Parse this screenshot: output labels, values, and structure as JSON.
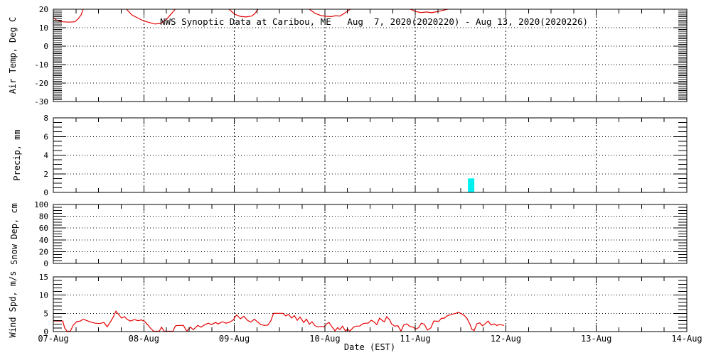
{
  "title": "NWS Synoptic Data at Caribou, ME   Aug  7, 2020(2020220) - Aug 13, 2020(2020226)",
  "line_color": "#e60000",
  "bar_color": "#00f0f0",
  "x_axis": {
    "label": "Date (EST)",
    "tick_labels": [
      "07-Aug",
      "08-Aug",
      "09-Aug",
      "10-Aug",
      "11-Aug",
      "12-Aug",
      "13-Aug",
      "14-Aug"
    ],
    "range_hours": [
      0,
      168
    ],
    "minor_tick_hours": 6,
    "major_tick_hours": 24
  },
  "chart_data": [
    {
      "id": "air-temp",
      "type": "line",
      "ylabel": "Air Temp, Deg C",
      "ylim": [
        -30,
        20
      ],
      "yticks": [
        -30,
        -20,
        -10,
        0,
        10,
        20
      ],
      "grid_yticks": [
        -20,
        -10,
        0,
        10
      ],
      "y_minor_step": 1,
      "clip_note": "curve clipped at 20 C panel top; data ends 12-Aug",
      "series": [
        {
          "name": "air-temp",
          "points": [
            [
              0,
              15.5
            ],
            [
              0.9,
              14
            ],
            [
              2.5,
              13.2
            ],
            [
              4.2,
              13
            ],
            [
              5.7,
              13.2
            ],
            [
              6.6,
              14.8
            ],
            [
              7.4,
              17
            ],
            [
              7.9,
              20
            ],
            [
              9.5,
              23
            ],
            [
              19.4,
              20
            ],
            [
              20.9,
              16.8
            ],
            [
              24,
              13.6
            ],
            [
              26.9,
              12
            ],
            [
              28.5,
              12.3
            ],
            [
              30,
              14.5
            ],
            [
              31.5,
              18
            ],
            [
              32.3,
              20
            ],
            [
              38.7,
              24
            ],
            [
              46.6,
              20
            ],
            [
              48.1,
              17.3
            ],
            [
              49.6,
              16.1
            ],
            [
              51.1,
              15.8
            ],
            [
              52.6,
              16.3
            ],
            [
              53.4,
              17.5
            ],
            [
              54.3,
              20
            ],
            [
              61.3,
              23
            ],
            [
              67.9,
              20
            ],
            [
              69.4,
              17.8
            ],
            [
              70.9,
              16.6
            ],
            [
              72.2,
              16.2
            ],
            [
              73.7,
              16
            ],
            [
              74.9,
              16.5
            ],
            [
              76,
              16.3
            ],
            [
              77.3,
              18
            ],
            [
              78.8,
              20
            ],
            [
              85.8,
              23
            ],
            [
              94.7,
              20
            ],
            [
              96.2,
              18.7
            ],
            [
              97.5,
              18.2
            ],
            [
              99,
              18.5
            ],
            [
              100.3,
              18.1
            ],
            [
              101.8,
              18.7
            ],
            [
              103.3,
              19.4
            ],
            [
              104.6,
              20
            ],
            [
              110.3,
              23
            ],
            [
              119.6,
              23
            ]
          ]
        }
      ]
    },
    {
      "id": "precip",
      "type": "bar",
      "ylabel": "Precip, mm",
      "ylim": [
        0,
        8
      ],
      "yticks": [
        0,
        2,
        4,
        6,
        8
      ],
      "grid_yticks": [
        2,
        4,
        6
      ],
      "y_minor_step": 0.5,
      "bars": [
        {
          "center_hour": 110.8,
          "width_hours": 1.7,
          "value_mm": 1.5
        }
      ],
      "series": []
    },
    {
      "id": "snow-depth",
      "type": "line",
      "ylabel": "Snow Dep, cm",
      "ylim": [
        0,
        100
      ],
      "yticks": [
        0,
        20,
        40,
        60,
        80,
        100
      ],
      "grid_yticks": [
        20,
        40,
        60,
        80
      ],
      "y_minor_step": 5,
      "series": []
    },
    {
      "id": "wind-speed",
      "type": "line",
      "ylabel": "Wind Spd, m/s",
      "ylim": [
        0,
        15
      ],
      "yticks": [
        0,
        5,
        10,
        15
      ],
      "grid_yticks": [
        5,
        10
      ],
      "y_minor_step": 1,
      "clip_note": "data ends 12-Aug",
      "series": [
        {
          "name": "wind-speed",
          "points": [
            [
              0,
              2.9
            ],
            [
              2.5,
              2.9
            ],
            [
              3,
              1
            ],
            [
              3.6,
              0.1
            ],
            [
              4.5,
              0.1
            ],
            [
              5.3,
              1.8
            ],
            [
              6.2,
              2.7
            ],
            [
              7.2,
              2.9
            ],
            [
              7.9,
              3.4
            ],
            [
              8.9,
              3
            ],
            [
              10,
              2.6
            ],
            [
              11.1,
              2.3
            ],
            [
              12.3,
              2.2
            ],
            [
              13.4,
              2.5
            ],
            [
              14.3,
              1.3
            ],
            [
              15.3,
              2.9
            ],
            [
              16,
              4.2
            ],
            [
              16.6,
              5.6
            ],
            [
              17.3,
              4.7
            ],
            [
              18.1,
              3.7
            ],
            [
              18.9,
              4.1
            ],
            [
              19.6,
              3.3
            ],
            [
              20.5,
              2.9
            ],
            [
              21.5,
              3.3
            ],
            [
              22.4,
              3
            ],
            [
              23.4,
              3.2
            ],
            [
              24.3,
              2.7
            ],
            [
              25.1,
              1.8
            ],
            [
              25.8,
              0.9
            ],
            [
              26.6,
              0.1
            ],
            [
              28.1,
              0.1
            ],
            [
              28.7,
              1.2
            ],
            [
              29.4,
              0.1
            ],
            [
              31.7,
              0.1
            ],
            [
              32.4,
              1.6
            ],
            [
              33.4,
              1.7
            ],
            [
              34.5,
              1.7
            ],
            [
              35.4,
              0.1
            ],
            [
              36.4,
              1.2
            ],
            [
              37.1,
              0.5
            ],
            [
              38.3,
              1.7
            ],
            [
              39.2,
              1.2
            ],
            [
              40,
              1.8
            ],
            [
              41.1,
              2.3
            ],
            [
              41.9,
              1.9
            ],
            [
              43,
              2.5
            ],
            [
              43.7,
              2.1
            ],
            [
              44.9,
              2.7
            ],
            [
              45.8,
              2.3
            ],
            [
              46.8,
              2.6
            ],
            [
              47.7,
              3.2
            ],
            [
              48.6,
              4.6
            ],
            [
              49.6,
              3.5
            ],
            [
              50.5,
              4.2
            ],
            [
              51.5,
              3.1
            ],
            [
              52.4,
              2.6
            ],
            [
              53.3,
              3.4
            ],
            [
              54.1,
              2.7
            ],
            [
              55,
              1.9
            ],
            [
              56,
              1.7
            ],
            [
              56.9,
              1.8
            ],
            [
              57.7,
              3
            ],
            [
              58.4,
              5
            ],
            [
              60.9,
              5
            ],
            [
              61.6,
              4.3
            ],
            [
              62.4,
              4.7
            ],
            [
              63.2,
              3.7
            ],
            [
              63.9,
              4.4
            ],
            [
              64.7,
              3.1
            ],
            [
              65.4,
              4
            ],
            [
              66.4,
              2.5
            ],
            [
              67.1,
              3.4
            ],
            [
              67.9,
              2
            ],
            [
              68.6,
              2.7
            ],
            [
              69.4,
              1.6
            ],
            [
              70.1,
              1.3
            ],
            [
              71.1,
              1.4
            ],
            [
              71.8,
              1.3
            ],
            [
              72.6,
              2.2
            ],
            [
              73.1,
              2.5
            ],
            [
              73.9,
              1.3
            ],
            [
              74.7,
              0.2
            ],
            [
              75.4,
              1.1
            ],
            [
              76,
              0.5
            ],
            [
              76.7,
              1.5
            ],
            [
              77.5,
              0.1
            ],
            [
              78,
              0.7
            ],
            [
              78.6,
              0.1
            ],
            [
              79.6,
              1.2
            ],
            [
              80.3,
              1.5
            ],
            [
              81.2,
              1.5
            ],
            [
              82,
              2.1
            ],
            [
              82.8,
              2.3
            ],
            [
              83.5,
              2.3
            ],
            [
              84.3,
              3.1
            ],
            [
              85,
              2.7
            ],
            [
              85.8,
              1.9
            ],
            [
              86.5,
              3.7
            ],
            [
              87.3,
              3
            ],
            [
              87.8,
              2.7
            ],
            [
              88.4,
              4.1
            ],
            [
              89.2,
              3.2
            ],
            [
              89.7,
              2.1
            ],
            [
              90.5,
              1.5
            ],
            [
              91.4,
              1.6
            ],
            [
              92.2,
              0.1
            ],
            [
              92.9,
              1.8
            ],
            [
              93.7,
              2.1
            ],
            [
              94.6,
              1.4
            ],
            [
              95.4,
              1.2
            ],
            [
              96.1,
              0.7
            ],
            [
              96.9,
              1.1
            ],
            [
              97.6,
              2.3
            ],
            [
              98.4,
              2
            ],
            [
              99.2,
              0.4
            ],
            [
              100.1,
              1
            ],
            [
              100.9,
              2.9
            ],
            [
              102.2,
              2.8
            ],
            [
              102.9,
              3.6
            ],
            [
              103.7,
              3.7
            ],
            [
              104.4,
              4.3
            ],
            [
              105.2,
              4.6
            ],
            [
              105.9,
              4.8
            ],
            [
              106.7,
              5
            ],
            [
              107.4,
              5.3
            ],
            [
              108.2,
              4.9
            ],
            [
              109,
              4.4
            ],
            [
              109.7,
              3.6
            ],
            [
              110.5,
              2
            ],
            [
              111,
              0.6
            ],
            [
              111.6,
              0.3
            ],
            [
              112.3,
              2.1
            ],
            [
              113.1,
              2.4
            ],
            [
              113.8,
              1.6
            ],
            [
              114.6,
              2.2
            ],
            [
              115.3,
              2.9
            ],
            [
              116.1,
              1.8
            ],
            [
              116.9,
              2.1
            ],
            [
              117.6,
              1.7
            ],
            [
              118.4,
              1.9
            ],
            [
              119.5,
              1.7
            ]
          ]
        }
      ]
    }
  ]
}
